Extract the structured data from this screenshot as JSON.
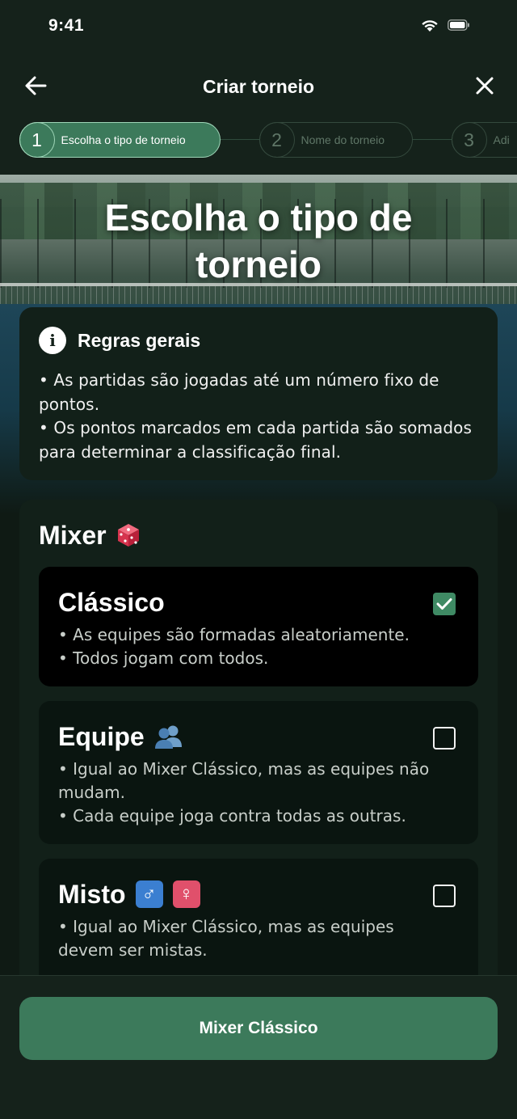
{
  "status_bar": {
    "time": "9:41"
  },
  "header": {
    "title": "Criar torneio"
  },
  "stepper": {
    "steps": [
      {
        "number": "1",
        "label": "Escolha o tipo de torneio",
        "active": true
      },
      {
        "number": "2",
        "label": "Nome do torneio",
        "active": false
      },
      {
        "number": "3",
        "label": "Adi",
        "active": false
      }
    ]
  },
  "hero": {
    "title_line1": "Escolha o tipo de",
    "title_line2": "torneio"
  },
  "rules": {
    "icon": "info-icon",
    "title": "Regras gerais",
    "line1": "• As partidas são jogadas até um número fixo de",
    "line2": "pontos.",
    "line3": "• Os pontos marcados em cada partida são somados",
    "line4": "para determinar a classificação final."
  },
  "mixer": {
    "title": "Mixer",
    "icon": "dice-icon",
    "options": [
      {
        "title": "Clássico",
        "selected": true,
        "desc1": "• As equipes são formadas aleatoriamente.",
        "desc2": "• Todos jogam com todos."
      },
      {
        "title": "Equipe",
        "icon": "people-icon",
        "selected": false,
        "desc1": "• Igual ao Mixer Clássico, mas as equipes não",
        "desc2": "mudam.",
        "desc3": "• Cada equipe joga contra todas as outras."
      },
      {
        "title": "Misto",
        "icons": [
          "male-sign-icon",
          "female-sign-icon"
        ],
        "male_glyph": "♂",
        "female_glyph": "♀",
        "selected": false,
        "desc1": "• Igual ao Mixer Clássico, mas as equipes",
        "desc2": "devem ser mistas."
      }
    ]
  },
  "footer": {
    "button_label": "Mixer Clássico"
  },
  "colors": {
    "background": "#0f1a14",
    "accent": "#3c7a5b",
    "card": "#122019",
    "male_badge": "#3b7fd1",
    "female_badge": "#e0506b"
  }
}
